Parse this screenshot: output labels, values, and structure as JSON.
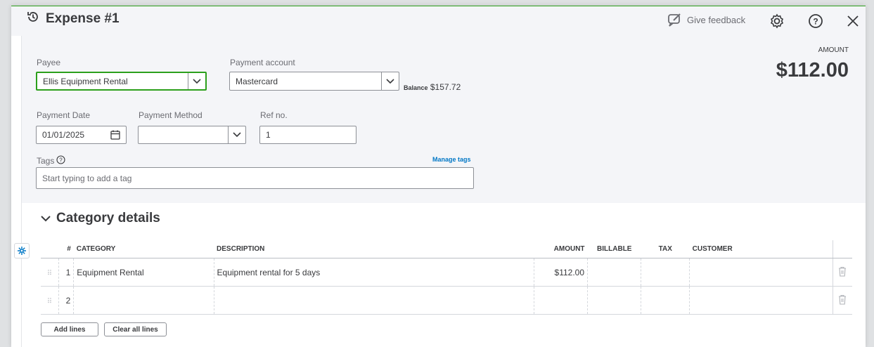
{
  "header": {
    "title": "Expense #1",
    "feedback_label": "Give feedback"
  },
  "form": {
    "payee": {
      "label": "Payee",
      "value": "Ellis Equipment Rental"
    },
    "payment_account": {
      "label": "Payment account",
      "value": "Mastercard",
      "balance_label": "Balance",
      "balance_value": "$157.72"
    },
    "amount": {
      "label": "AMOUNT",
      "value": "$112.00"
    },
    "payment_date": {
      "label": "Payment Date",
      "value": "01/01/2025"
    },
    "payment_method": {
      "label": "Payment Method",
      "value": ""
    },
    "ref_no": {
      "label": "Ref no.",
      "value": "1"
    },
    "tags": {
      "label": "Tags",
      "manage_label": "Manage tags",
      "placeholder": "Start typing to add a tag"
    }
  },
  "category_details": {
    "title": "Category details",
    "columns": [
      "#",
      "CATEGORY",
      "DESCRIPTION",
      "AMOUNT",
      "BILLABLE",
      "TAX",
      "CUSTOMER"
    ],
    "rows": [
      {
        "num": "1",
        "category": "Equipment Rental",
        "description": "Equipment rental for 5 days",
        "amount": "$112.00"
      },
      {
        "num": "2",
        "category": "",
        "description": "",
        "amount": ""
      }
    ],
    "add_lines_label": "Add lines",
    "clear_lines_label": "Clear all lines"
  },
  "colors": {
    "accent_green": "#2ca01c",
    "link_blue": "#0077c5",
    "page_bg": "#f4f5f8"
  }
}
